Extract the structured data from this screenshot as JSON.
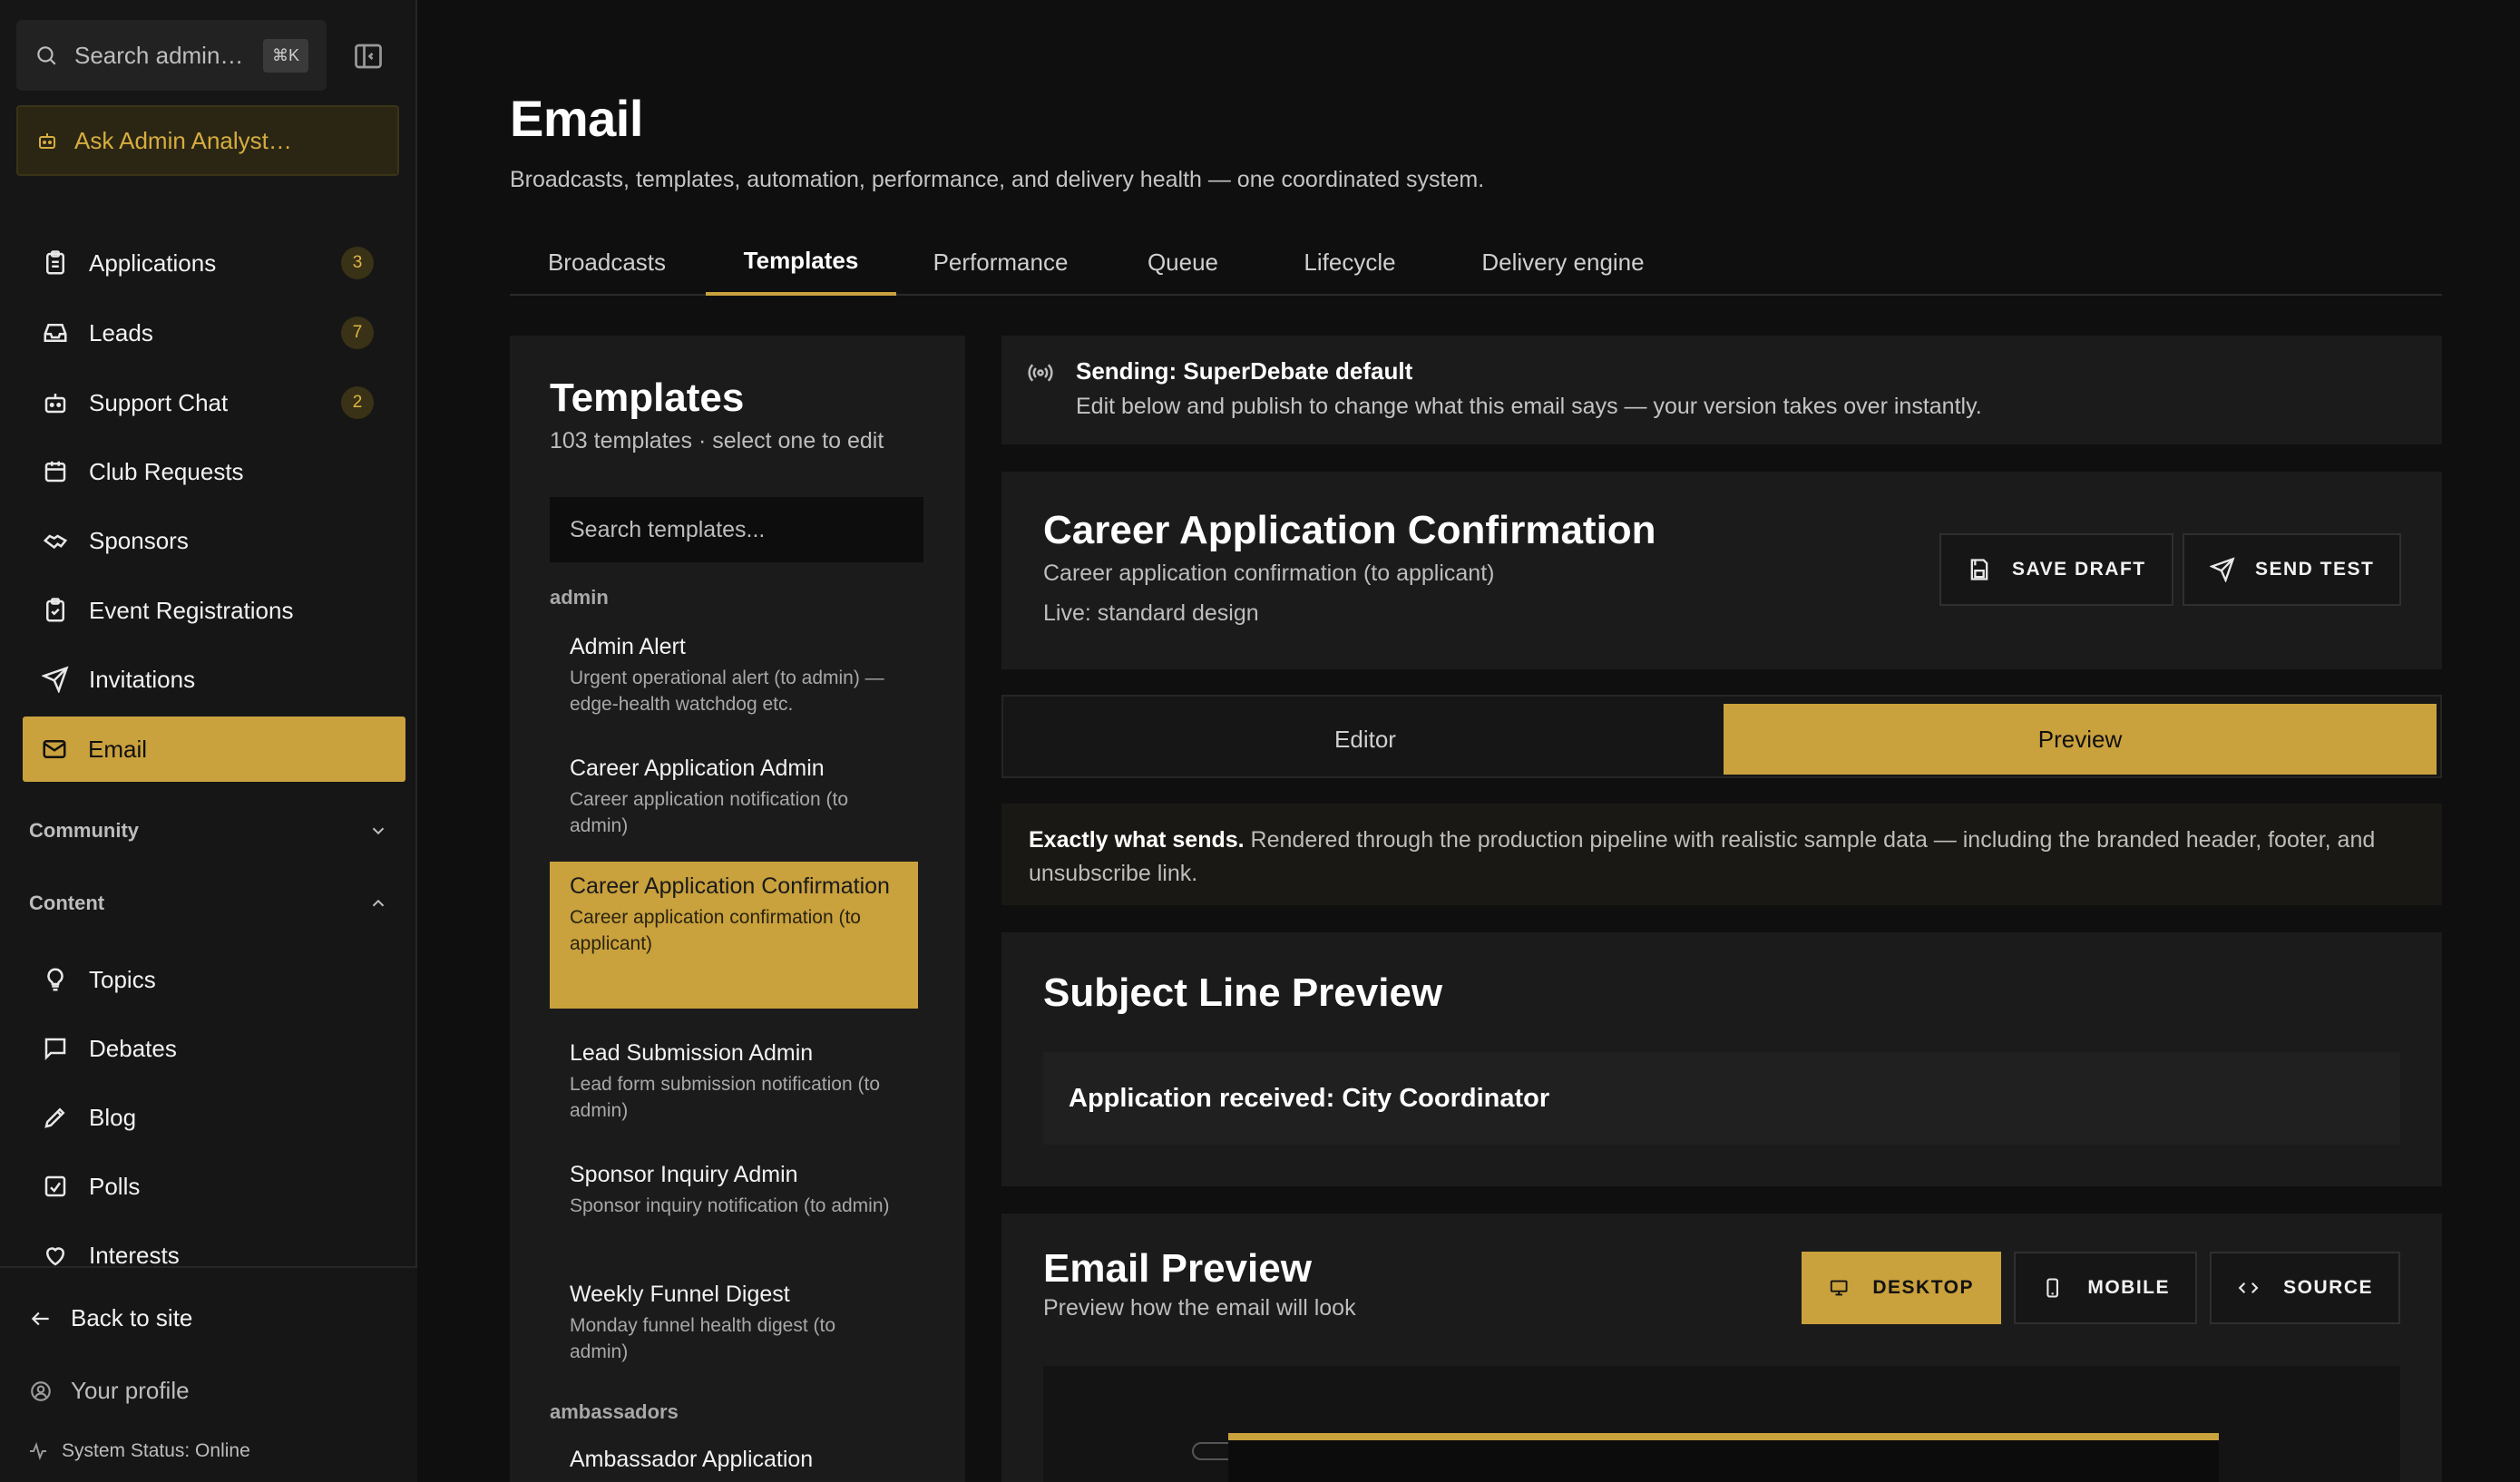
{
  "sidebar": {
    "search_placeholder": "Search admin…",
    "search_shortcut": "⌘K",
    "ask_label": "Ask Admin Analyst…",
    "items": [
      {
        "label": "Applications",
        "badge": "3",
        "icon": "clipboard-icon"
      },
      {
        "label": "Leads",
        "badge": "7",
        "icon": "inbox-icon"
      },
      {
        "label": "Support Chat",
        "badge": "2",
        "icon": "bot-icon"
      },
      {
        "label": "Club Requests",
        "badge": "",
        "icon": "calendar-icon"
      },
      {
        "label": "Sponsors",
        "badge": "",
        "icon": "handshake-icon"
      },
      {
        "label": "Event Registrations",
        "badge": "",
        "icon": "clipboard-check-icon"
      },
      {
        "label": "Invitations",
        "badge": "",
        "icon": "send-icon"
      },
      {
        "label": "Email",
        "badge": "",
        "icon": "mail-icon",
        "active": true
      }
    ],
    "sections": [
      {
        "label": "Community",
        "collapsed": true
      },
      {
        "label": "Content",
        "collapsed": false
      }
    ],
    "content_items": [
      {
        "label": "Topics",
        "icon": "lightbulb-icon"
      },
      {
        "label": "Debates",
        "icon": "message-square-icon"
      },
      {
        "label": "Blog",
        "icon": "pen-icon"
      },
      {
        "label": "Polls",
        "icon": "poll-icon"
      },
      {
        "label": "Interests",
        "icon": "heart-icon"
      }
    ],
    "footer": {
      "back_label": "Back to site",
      "profile_label": "Your profile",
      "status_label": "System Status: Online"
    }
  },
  "page": {
    "title": "Email",
    "subtitle": "Broadcasts, templates, automation, performance, and delivery health — one coordinated system."
  },
  "tabs": [
    "Broadcasts",
    "Templates",
    "Performance",
    "Queue",
    "Lifecycle",
    "Delivery engine"
  ],
  "active_tab": "Templates",
  "templates": {
    "title": "Templates",
    "count_text": "103 templates · select one to edit",
    "search_placeholder": "Search templates...",
    "groups": [
      {
        "label": "admin",
        "items": [
          {
            "name": "Admin Alert",
            "desc": "Urgent operational alert (to admin) — edge-health watchdog etc."
          },
          {
            "name": "Career Application Admin",
            "desc": "Career application notification (to admin)"
          },
          {
            "name": "Career Application Confirmation",
            "desc": "Career application confirmation (to applicant)",
            "selected": true
          },
          {
            "name": "Lead Submission Admin",
            "desc": "Lead form submission notification (to admin)"
          },
          {
            "name": "Sponsor Inquiry Admin",
            "desc": "Sponsor inquiry notification (to admin)"
          },
          {
            "name": "Weekly Funnel Digest",
            "desc": "Monday funnel health digest (to admin)"
          }
        ]
      },
      {
        "label": "ambassadors",
        "items": [
          {
            "name": "Ambassador Application",
            "desc": ""
          }
        ]
      }
    ]
  },
  "banner": {
    "title": "Sending: SuperDebate default",
    "text": "Edit below and publish to change what this email says — your version takes over instantly."
  },
  "template_header": {
    "title": "Career Application Confirmation",
    "desc": "Career application confirmation (to applicant)",
    "live": "Live: standard design",
    "save_label": "SAVE DRAFT",
    "send_label": "SEND TEST"
  },
  "mode": {
    "editor_label": "Editor",
    "preview_label": "Preview",
    "active": "Preview"
  },
  "note": {
    "strong": "Exactly what sends.",
    "text": " Rendered through the production pipeline with realistic sample data — including the branded header, footer, and unsubscribe link."
  },
  "subject": {
    "title": "Subject Line Preview",
    "value": "Application received: City Coordinator"
  },
  "email_preview": {
    "title": "Email Preview",
    "subtitle": "Preview how the email will look",
    "desktop_label": "DESKTOP",
    "mobile_label": "MOBILE",
    "source_label": "SOURCE",
    "active_device": "DESKTOP"
  },
  "colors": {
    "accent": "#c9a13d",
    "background": "#0f0f0f",
    "panel": "#1b1b1b"
  }
}
